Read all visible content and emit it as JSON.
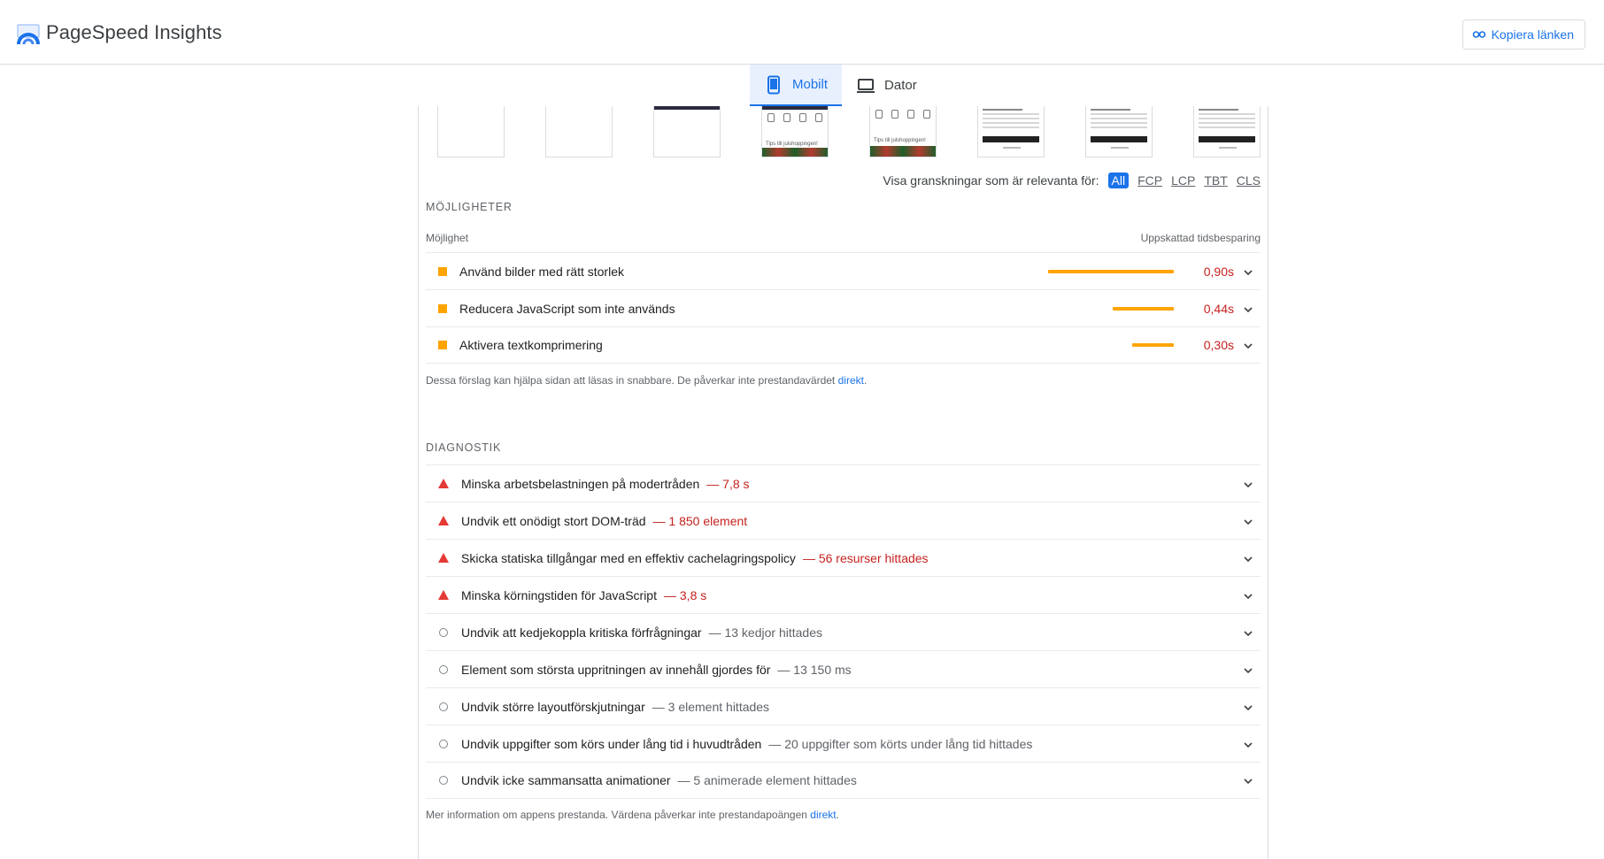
{
  "header": {
    "app_title": "PageSpeed Insights",
    "copy_link_label": "Kopiera länken",
    "logo_icon": "pagespeed-logo-icon",
    "colors": {
      "accent": "#1a73e8",
      "fail": "#c5221f",
      "warn": "#ffa400",
      "fail_icon": "#e53935"
    }
  },
  "tabs": [
    {
      "label": "Mobilt",
      "icon": "mobile-icon",
      "active": true
    },
    {
      "label": "Dator",
      "icon": "laptop-icon",
      "active": false
    }
  ],
  "filmstrip": {
    "frame_text": [
      "Tips till julshoppingen!",
      "Tips till julshoppingen!"
    ]
  },
  "filter": {
    "label": "Visa granskningar som är relevanta för:",
    "options": [
      "All",
      "FCP",
      "LCP",
      "TBT",
      "CLS"
    ],
    "selected": "All"
  },
  "opportunities": {
    "title": "MÖJLIGHETER",
    "col_left": "Möjlighet",
    "col_right": "Uppskattad tidsbesparing",
    "items": [
      {
        "label": "Använd bilder med rätt storlek",
        "saving": "0,90s",
        "seconds": 0.9
      },
      {
        "label": "Reducera JavaScript som inte används",
        "saving": "0,44s",
        "seconds": 0.44
      },
      {
        "label": "Aktivera textkomprimering",
        "saving": "0,30s",
        "seconds": 0.3
      }
    ],
    "note": "Dessa förslag kan hjälpa sidan att läsas in snabbare. De påverkar inte prestandavärdet",
    "note_link": "direkt"
  },
  "diagnostics": {
    "title": "DIAGNOSTIK",
    "items": [
      {
        "label": "Minska arbetsbelastningen på modertråden",
        "detail": "— 7,8 s",
        "status": "fail"
      },
      {
        "label": "Undvik ett onödigt stort DOM-träd",
        "detail": "— 1 850 element",
        "status": "fail"
      },
      {
        "label": "Skicka statiska tillgångar med en effektiv cachelagringspolicy",
        "detail": "— 56 resurser hittades",
        "status": "fail"
      },
      {
        "label": "Minska körningstiden för JavaScript",
        "detail": "— 3,8 s",
        "status": "fail"
      },
      {
        "label": "Undvik att kedjekoppla kritiska förfrågningar",
        "detail": "— 13 kedjor hittades",
        "status": "info"
      },
      {
        "label": "Element som största uppritningen av innehåll gjordes för",
        "detail": "— 13 150 ms",
        "status": "info"
      },
      {
        "label": "Undvik större layoutförskjutningar",
        "detail": "— 3 element hittades",
        "status": "info"
      },
      {
        "label": "Undvik uppgifter som körs under lång tid i huvudtråden",
        "detail": "— 20 uppgifter som körts under lång tid hittades",
        "status": "info"
      },
      {
        "label": "Undvik icke sammansatta animationer",
        "detail": "— 5 animerade element hittades",
        "status": "info"
      }
    ],
    "note": "Mer information om appens prestanda. Värdena påverkar inte prestandapoängen",
    "note_link": "direkt"
  }
}
